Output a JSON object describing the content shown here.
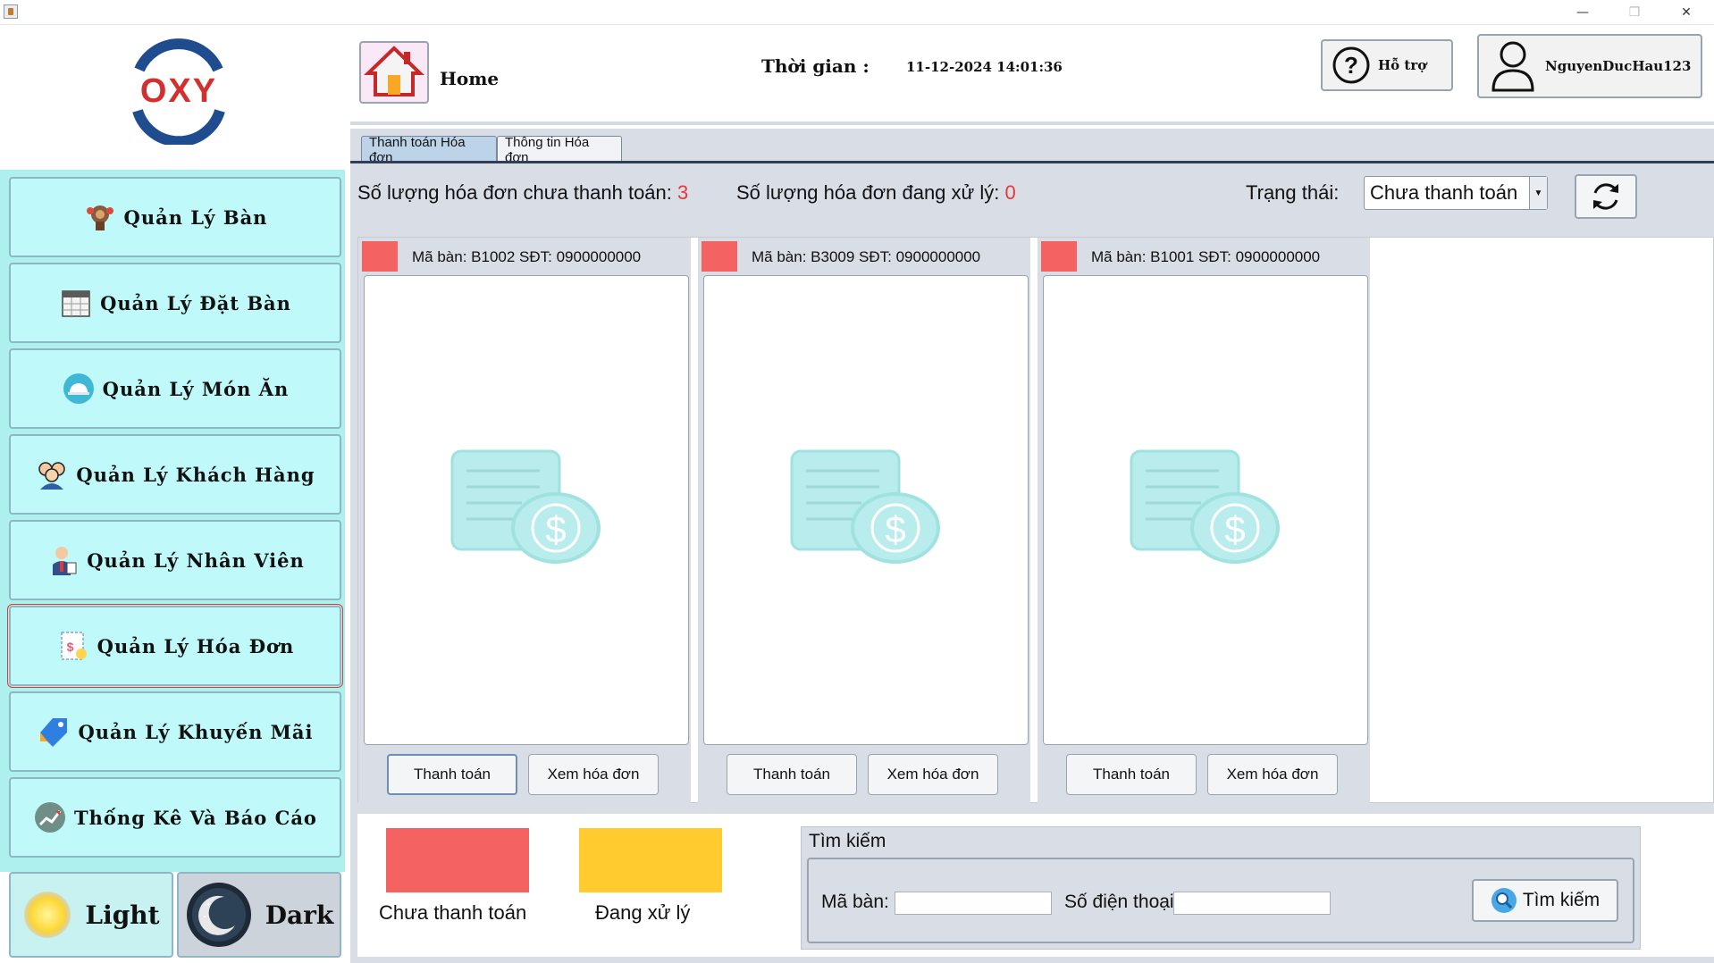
{
  "window": {
    "minimize": "—",
    "maximize": "❐",
    "close": "✕"
  },
  "logo": {
    "text": "OXY"
  },
  "sidebar": {
    "items": [
      {
        "label": "Quản Lý Bàn",
        "icon": "table-management-icon"
      },
      {
        "label": "Quản Lý Đặt Bàn",
        "icon": "calendar-icon"
      },
      {
        "label": "Quản Lý Món Ăn",
        "icon": "food-dish-icon"
      },
      {
        "label": "Quản Lý Khách Hàng",
        "icon": "customers-icon"
      },
      {
        "label": "Quản Lý Nhân Viên",
        "icon": "employee-icon"
      },
      {
        "label": "Quản Lý Hóa Đơn",
        "icon": "invoice-icon",
        "active": true
      },
      {
        "label": "Quản Lý Khuyến Mãi",
        "icon": "promotion-tag-icon"
      },
      {
        "label": "Thống Kê Và Báo Cáo",
        "icon": "statistics-icon"
      }
    ],
    "theme": {
      "light": "Light",
      "dark": "Dark"
    }
  },
  "header": {
    "home_label": "Home",
    "time_label": "Thời gian :",
    "time_value": "11-12-2024 14:01:36",
    "help_label": "Hỗ trợ",
    "username": "NguyenDucHau123"
  },
  "tabs": [
    {
      "label": "Thanh toán Hóa đơn",
      "active": true
    },
    {
      "label": "Thông tin Hóa đơn",
      "active": false
    }
  ],
  "stats": {
    "unpaid_label": "Số lượng hóa đơn chưa thanh toán:",
    "unpaid_count": "3",
    "processing_label": "Số lượng hóa đơn đang xử lý:",
    "processing_count": "0",
    "status_label": "Trạng thái:",
    "status_selected": "Chưa thanh toán"
  },
  "cards": [
    {
      "header": "Mã bàn: B1002   SĐT: 0900000000",
      "pay_label": "Thanh toán",
      "view_label": "Xem hóa đơn"
    },
    {
      "header": "Mã bàn: B3009   SĐT: 0900000000",
      "pay_label": "Thanh toán",
      "view_label": "Xem hóa đơn"
    },
    {
      "header": "Mã bàn: B1001   SĐT: 0900000000",
      "pay_label": "Thanh toán",
      "view_label": "Xem hóa đơn"
    }
  ],
  "legend": {
    "unpaid": {
      "label": "Chưa thanh toán",
      "color": "#f56262"
    },
    "processing": {
      "label": "Đang xử lý",
      "color": "#ffcb2f"
    }
  },
  "search": {
    "title": "Tìm kiếm",
    "table_label": "Mã bàn:",
    "table_value": "",
    "phone_label": "Số điện thoại:",
    "phone_value": "",
    "button_label": "Tìm kiếm"
  },
  "colors": {
    "accent_teal": "#bff9f9",
    "unpaid_red": "#f56262",
    "processing_yellow": "#ffcb2f",
    "count_red": "#e53935"
  }
}
